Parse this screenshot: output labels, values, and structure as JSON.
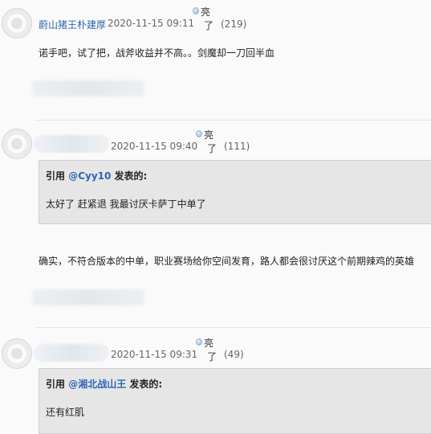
{
  "posts": [
    {
      "username": "蔚山猪王朴建厚",
      "time": "2020-11-15 09:11",
      "like_label": "亮",
      "like_label2": "了",
      "like_count": "(219)",
      "text": "诺手吧，试了把，战斧收益并不高。。剑魔却一刀回半血"
    },
    {
      "time": "2020-11-15 09:40",
      "like_label": "亮",
      "like_label2": "了",
      "like_count": "(111)",
      "quote": {
        "prefix": "引用 ",
        "quoted_user": "@Cyy10",
        "suffix": " 发表的:",
        "text": "太好了 赶紧退 我最讨厌卡萨丁中单了"
      },
      "text": "确实，不符合版本的中单，职业赛场给你空间发育，路人都会很讨厌这个前期辣鸡的英雄"
    },
    {
      "time": "2020-11-15 09:31",
      "like_label": "亮",
      "like_label2": "了",
      "like_count": "(49)",
      "quote": {
        "prefix": "引用 ",
        "quoted_user": "@湘北战山王",
        "suffix": " 发表的:",
        "text": "还有红肌"
      }
    }
  ]
}
